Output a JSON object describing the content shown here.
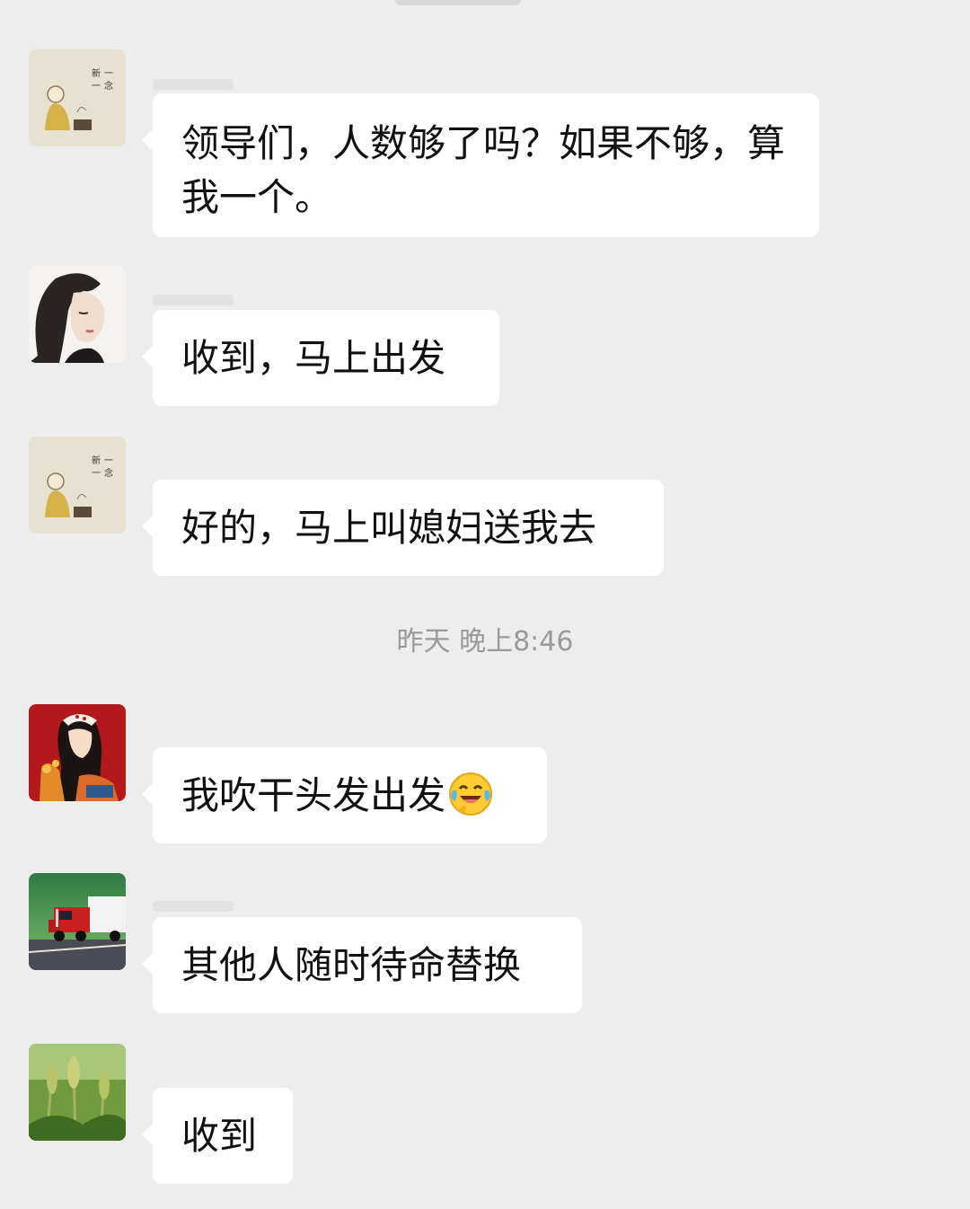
{
  "messages": [
    {
      "text": "领导们，人数够了吗？如果不够，算我一个。",
      "avatar": "painting-avatar-icon"
    },
    {
      "text": "收到，马上出发",
      "avatar": "woman-portrait-avatar-icon"
    },
    {
      "text": "好的，马上叫媳妇送我去",
      "avatar": "painting-avatar-icon"
    },
    {
      "text": "我吹干头发出发",
      "avatar": "girl-red-avatar-icon",
      "emoji": "laughing-tears-emoji"
    },
    {
      "text": "其他人随时待命替换",
      "avatar": "truck-avatar-icon"
    },
    {
      "text": "收到",
      "avatar": "wheat-avatar-icon"
    }
  ],
  "time_separator": "昨天 晚上8:46",
  "colors": {
    "background": "#ededed",
    "bubble": "#ffffff",
    "timestamp": "#9a9a9a"
  }
}
